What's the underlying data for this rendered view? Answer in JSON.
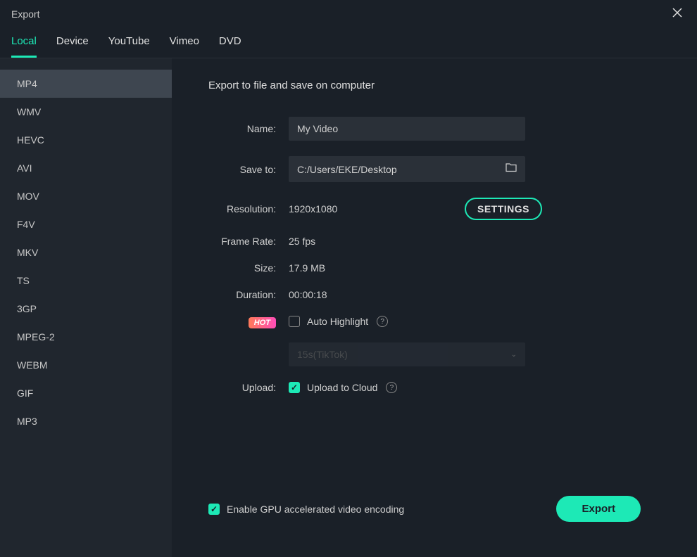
{
  "titlebar": {
    "title": "Export"
  },
  "tabs": [
    {
      "label": "Local",
      "active": true
    },
    {
      "label": "Device",
      "active": false
    },
    {
      "label": "YouTube",
      "active": false
    },
    {
      "label": "Vimeo",
      "active": false
    },
    {
      "label": "DVD",
      "active": false
    }
  ],
  "formats": [
    {
      "label": "MP4",
      "active": true
    },
    {
      "label": "WMV",
      "active": false
    },
    {
      "label": "HEVC",
      "active": false
    },
    {
      "label": "AVI",
      "active": false
    },
    {
      "label": "MOV",
      "active": false
    },
    {
      "label": "F4V",
      "active": false
    },
    {
      "label": "MKV",
      "active": false
    },
    {
      "label": "TS",
      "active": false
    },
    {
      "label": "3GP",
      "active": false
    },
    {
      "label": "MPEG-2",
      "active": false
    },
    {
      "label": "WEBM",
      "active": false
    },
    {
      "label": "GIF",
      "active": false
    },
    {
      "label": "MP3",
      "active": false
    }
  ],
  "main": {
    "heading": "Export to file and save on computer",
    "name_label": "Name:",
    "name_value": "My Video",
    "save_to_label": "Save to:",
    "save_to_value": "C:/Users/EKE/Desktop",
    "resolution_label": "Resolution:",
    "resolution_value": "1920x1080",
    "settings_btn": "SETTINGS",
    "frame_rate_label": "Frame Rate:",
    "frame_rate_value": "25 fps",
    "size_label": "Size:",
    "size_value": "17.9 MB",
    "duration_label": "Duration:",
    "duration_value": "00:00:18",
    "hot_badge": "HOT",
    "auto_highlight_label": "Auto Highlight",
    "auto_highlight_checked": false,
    "highlight_preset": "15s(TikTok)",
    "upload_label": "Upload:",
    "upload_to_cloud_label": "Upload to Cloud",
    "upload_checked": true
  },
  "footer": {
    "gpu_label": "Enable GPU accelerated video encoding",
    "gpu_checked": true,
    "export_btn": "Export"
  }
}
